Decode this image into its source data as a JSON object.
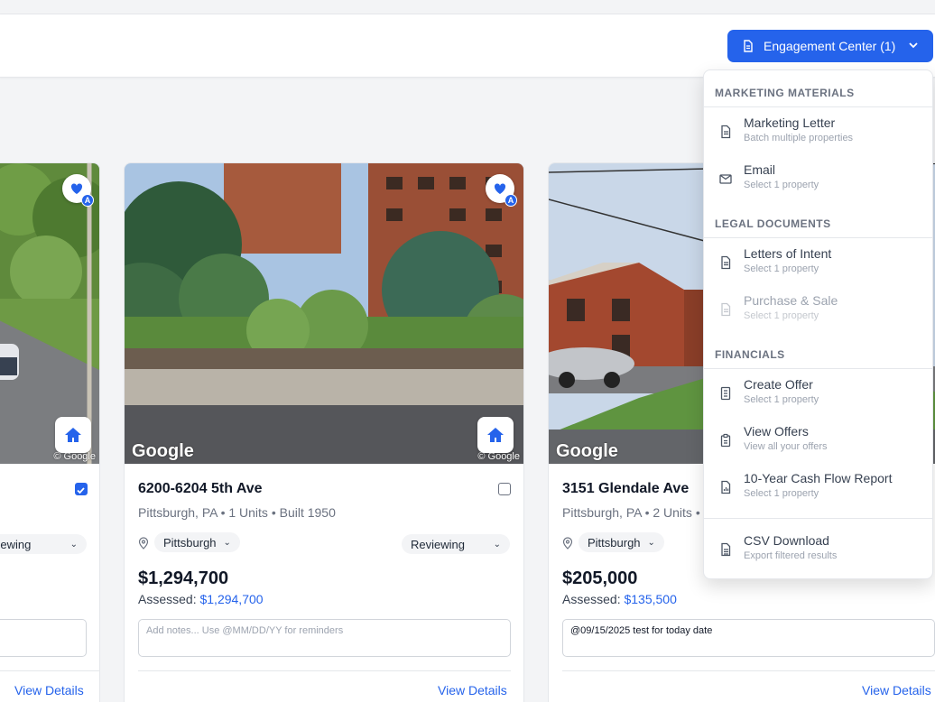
{
  "header": {
    "engagement_button": "Engagement Center (1)"
  },
  "cards": [
    {
      "address": "",
      "meta": "",
      "location": "",
      "status": "viewing",
      "price": "",
      "assessed_label": "",
      "assessed_value": "",
      "notes": "",
      "view_details": "View Details",
      "checked": true
    },
    {
      "address": "6200-6204 5th Ave",
      "meta": "Pittsburgh, PA • 1 Units • Built 1950",
      "location": "Pittsburgh",
      "status": "Reviewing",
      "price": "$1,294,700",
      "assessed_label": "Assessed: ",
      "assessed_value": "$1,294,700",
      "notes_placeholder": "Add notes... Use @MM/DD/YY for reminders",
      "view_details": "View Details",
      "checked": false
    },
    {
      "address": "3151 Glendale Ave",
      "meta": "Pittsburgh, PA • 2 Units •",
      "location": "Pittsburgh",
      "price": "$205,000",
      "assessed_label": "Assessed: ",
      "assessed_value": "$135,500",
      "notes": "@09/15/2025 test for today date",
      "view_details": "View Details"
    }
  ],
  "photo": {
    "watermark": "Google",
    "copyright": "© Google",
    "avatar_badge": "A"
  },
  "dropdown": {
    "sections": [
      {
        "title": "MARKETING MATERIALS",
        "items": [
          {
            "title": "Marketing Letter",
            "subtitle": "Batch multiple properties",
            "icon": "document-icon",
            "enabled": true
          },
          {
            "title": "Email",
            "subtitle": "Select 1 property",
            "icon": "envelope-icon",
            "enabled": true
          }
        ]
      },
      {
        "title": "LEGAL DOCUMENTS",
        "items": [
          {
            "title": "Letters of Intent",
            "subtitle": "Select 1 property",
            "icon": "document-icon",
            "enabled": true
          },
          {
            "title": "Purchase & Sale",
            "subtitle": "Select 1 property",
            "icon": "document-icon",
            "enabled": false
          }
        ]
      },
      {
        "title": "FINANCIALS",
        "items": [
          {
            "title": "Create Offer",
            "subtitle": "Select 1 property",
            "icon": "receipt-icon",
            "enabled": true
          },
          {
            "title": "View Offers",
            "subtitle": "View all your offers",
            "icon": "clipboard-icon",
            "enabled": true
          },
          {
            "title": "10-Year Cash Flow Report",
            "subtitle": "Select 1 property",
            "icon": "report-icon",
            "enabled": true
          }
        ]
      }
    ],
    "footer_item": {
      "title": "CSV Download",
      "subtitle": "Export filtered results",
      "icon": "spreadsheet-icon",
      "enabled": true
    }
  },
  "colors": {
    "accent": "#2563eb",
    "muted": "#6b7280"
  }
}
